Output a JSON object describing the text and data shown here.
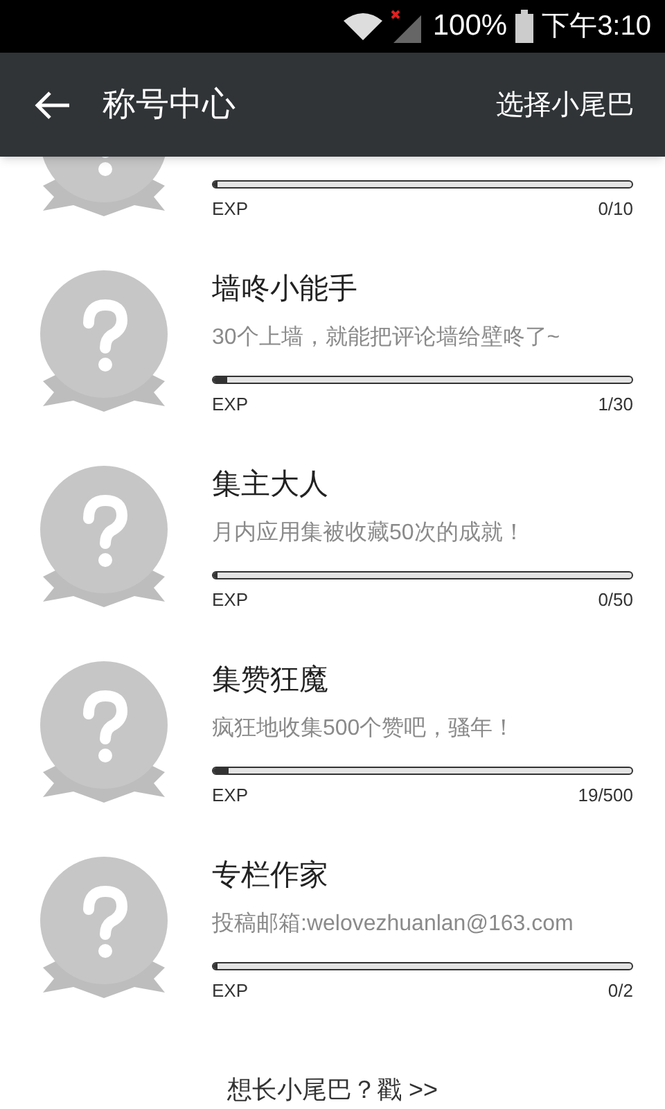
{
  "status_bar": {
    "battery": "100%",
    "time": "下午3:10"
  },
  "header": {
    "title": "称号中心",
    "action": "选择小尾巴"
  },
  "titles": [
    {
      "exp_label": "EXP",
      "reading": "0/10",
      "level": 0
    },
    {
      "name": "墙咚小能手",
      "description": "30个上墙，就能把评论墙给壁咚了~",
      "exp_label": "EXP",
      "reading": "1/30",
      "level": 0.033
    },
    {
      "name": "集主大人",
      "description": "月内应用集被收藏50次的成就！",
      "exp_label": "EXP",
      "reading": "0/50",
      "level": 0
    },
    {
      "name": "集赞狂魔",
      "description": "疯狂地收集500个赞吧，骚年！",
      "exp_label": "EXP",
      "reading": "19/500",
      "level": 0.038
    },
    {
      "name": "专栏作家",
      "description": "投稿邮箱:welovezhuanlan@163.com",
      "exp_label": "EXP",
      "reading": "0/2",
      "level": 0
    }
  ],
  "footer_link": "想长小尾巴？戳 >>"
}
